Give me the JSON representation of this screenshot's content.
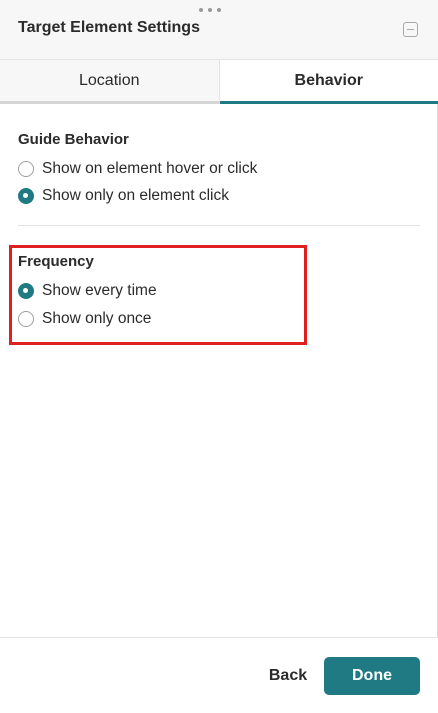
{
  "header": {
    "title": "Target Element Settings"
  },
  "tabs": [
    {
      "label": "Location",
      "active": false
    },
    {
      "label": "Behavior",
      "active": true
    }
  ],
  "guide_behavior": {
    "title": "Guide Behavior",
    "options": [
      {
        "label": "Show on element hover or click",
        "checked": false
      },
      {
        "label": "Show only on element click",
        "checked": true
      }
    ]
  },
  "frequency": {
    "title": "Frequency",
    "options": [
      {
        "label": "Show every time",
        "checked": true
      },
      {
        "label": "Show only once",
        "checked": false
      }
    ]
  },
  "footer": {
    "back_label": "Back",
    "done_label": "Done"
  },
  "colors": {
    "accent": "#1f7a83",
    "highlight": "#e02020"
  }
}
